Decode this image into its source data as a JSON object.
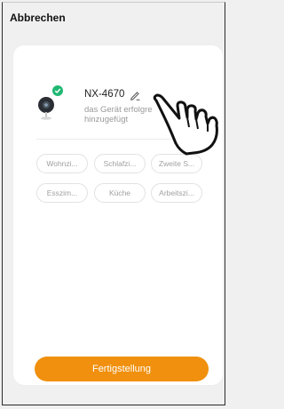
{
  "header": {
    "cancel_label": "Abbrechen"
  },
  "device": {
    "name": "NX-4670",
    "status": "das Gerät erfolgreich hinzugefügt",
    "status_visible": "das Gerät erfolgre\nhinzugefügt"
  },
  "rooms": [
    "Wohnzi...",
    "Schlafzi...",
    "Zweite S...",
    "Esszim...",
    "Küche",
    "Arbeitszi..."
  ],
  "footer": {
    "finish_label": "Fertigstellung"
  },
  "colors": {
    "accent": "#f0900e",
    "success": "#1fb873"
  }
}
